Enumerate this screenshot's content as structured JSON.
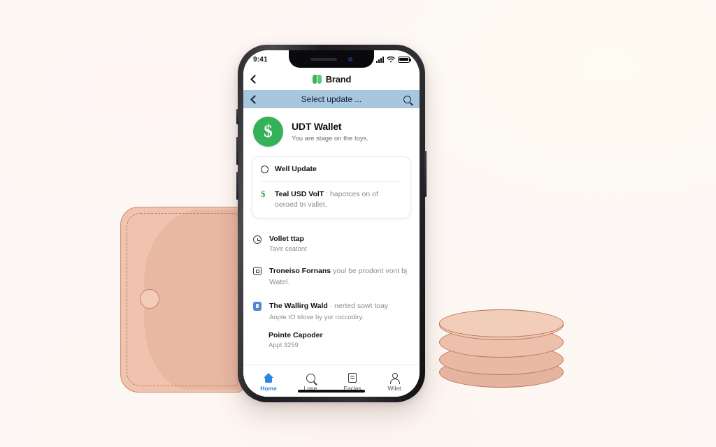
{
  "scene": {
    "background_color": "#fdf8f5",
    "objects": [
      {
        "name": "leather-wallet",
        "color": "#efc3ae"
      },
      {
        "name": "coin-stack",
        "color": "#edc0ab",
        "count": 4
      }
    ]
  },
  "phone": {
    "frame_color": "#2b2b2f",
    "status_bar": {
      "time": "9:41",
      "icons": [
        "signal-bars-icon",
        "wifi-icon",
        "battery-icon"
      ]
    },
    "brand_header": {
      "back_icon": "chevron-left-icon",
      "logo_icon": "leaf-logo-icon",
      "title": "Brand"
    },
    "select_bar": {
      "background_color": "#a9c6df",
      "back_icon": "chevron-left-icon",
      "title": "Select update ...",
      "search_icon": "search-icon"
    },
    "hero": {
      "avatar_icon": "dollar-sign-icon",
      "avatar_color": "#35b15a",
      "avatar_glyph": "$",
      "title": "UDT Wallet",
      "subtitle": "You are stage on the toys."
    },
    "card": {
      "rows": [
        {
          "icon": "circle-outline-icon",
          "label": "Well Update",
          "text": "",
          "muted": ""
        },
        {
          "icon": "dollar-sign-icon",
          "label": "Teal USD VolT",
          "text": "Teal USD VolT",
          "muted": " : hapotces on of oeroed tn vallet."
        }
      ]
    },
    "list": [
      {
        "icon": "clock-icon",
        "title": "Vollet ttap",
        "muted": "",
        "sub": "Tavir ceatont"
      },
      {
        "icon": "transfer-square-icon",
        "title": "Troneiso Fornans",
        "muted": " youl be prodont vont bj Watel.",
        "sub": ""
      },
      {
        "icon": "blue-card-icon",
        "title": "The Wallirg Wald",
        "muted": " · nerted sowt toay",
        "sub": "Aopte tO tdove by yor roccodiry."
      }
    ],
    "tail": {
      "title": "Pointe Capoder",
      "subtitle": "Appl 3259"
    },
    "tabbar": {
      "items": [
        {
          "icon": "home-icon",
          "label": "Home",
          "active": true
        },
        {
          "icon": "search-icon",
          "label": "Lone",
          "active": false
        },
        {
          "icon": "document-icon",
          "label": "Eaclas",
          "active": false
        },
        {
          "icon": "person-icon",
          "label": "Wilet",
          "active": false
        }
      ],
      "active_color": "#2e86de"
    }
  }
}
